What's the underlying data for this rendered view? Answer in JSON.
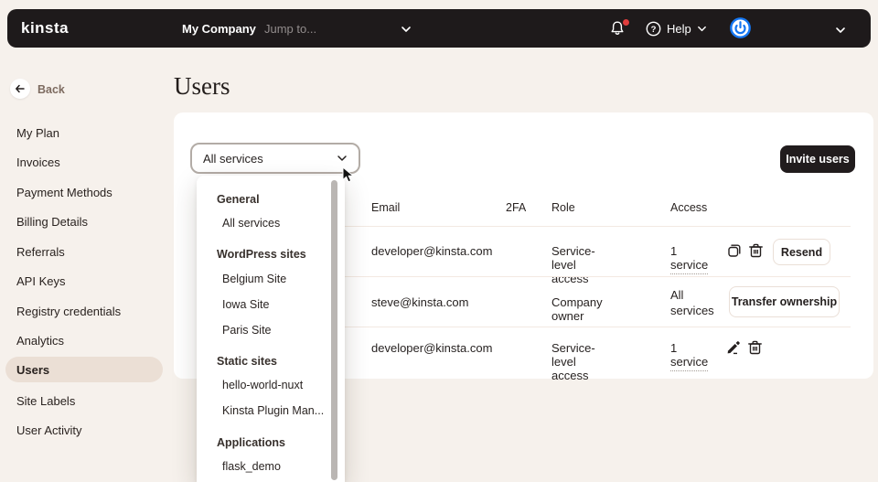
{
  "navbar": {
    "logo": "kinsta",
    "company": "My Company",
    "jump_placeholder": "Jump to...",
    "help_label": "Help"
  },
  "sidebar": {
    "back_label": "Back",
    "items": [
      {
        "label": "My Plan",
        "active": false
      },
      {
        "label": "Invoices",
        "active": false
      },
      {
        "label": "Payment Methods",
        "active": false
      },
      {
        "label": "Billing Details",
        "active": false
      },
      {
        "label": "Referrals",
        "active": false
      },
      {
        "label": "API Keys",
        "active": false
      },
      {
        "label": "Registry credentials",
        "active": false
      },
      {
        "label": "Analytics",
        "active": false
      },
      {
        "label": "Users",
        "active": true
      },
      {
        "label": "Site Labels",
        "active": false
      },
      {
        "label": "User Activity",
        "active": false
      }
    ]
  },
  "page": {
    "title": "Users"
  },
  "toolbar": {
    "filter_value": "All services",
    "invite_label": "Invite users"
  },
  "dropdown": {
    "groups": [
      {
        "label": "General",
        "items": [
          "All services"
        ]
      },
      {
        "label": "WordPress sites",
        "items": [
          "Belgium Site",
          "Iowa Site",
          "Paris Site"
        ]
      },
      {
        "label": "Static sites",
        "items": [
          "hello-world-nuxt",
          "Kinsta Plugin Man..."
        ]
      },
      {
        "label": "Applications",
        "items": [
          "flask_demo"
        ]
      }
    ]
  },
  "table": {
    "headers": [
      "Email",
      "2FA",
      "Role",
      "Access"
    ],
    "rows": [
      {
        "email": "developer@kinsta.com",
        "twofa": "",
        "role": "Service-level access",
        "access": "1 service",
        "button": "Resend"
      },
      {
        "email": "steve@kinsta.com",
        "twofa": "",
        "role": "Company owner",
        "access": "All services",
        "button": "Transfer ownership"
      },
      {
        "email": "developer@kinsta.com",
        "twofa": "",
        "role": "Service-level access",
        "access": "1 service",
        "button": ""
      }
    ]
  },
  "colors": {
    "navbar_bg": "#1e1a1b",
    "page_bg": "#f6f1ec",
    "active_pill": "#ebdfd5",
    "accent_blue": "#1476f2",
    "notification_red": "#e03d3d"
  }
}
